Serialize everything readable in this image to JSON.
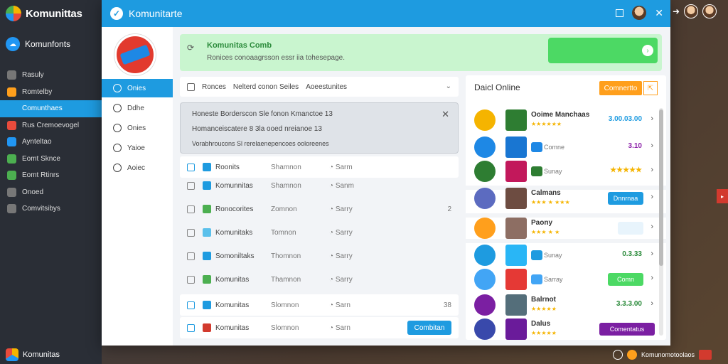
{
  "app": {
    "name": "Komunittas"
  },
  "account": {
    "name": "Komunfonts"
  },
  "sidebar": {
    "items": [
      {
        "label": "Rasuly",
        "color": "#777"
      },
      {
        "label": "Romtelby",
        "color": "#ff9f1c"
      },
      {
        "label": "Comunthaes",
        "color": "#1e9be0"
      },
      {
        "label": "Rus Cremoevogel",
        "color": "#e84b3c"
      },
      {
        "label": "Aynteltao",
        "color": "#2196f3"
      },
      {
        "label": "Eomt Sknce",
        "color": "#4caf50"
      },
      {
        "label": "Eomt Rtinrs",
        "color": "#4caf50"
      },
      {
        "label": "Onoed",
        "color": "#777"
      },
      {
        "label": "Comvitsibys",
        "color": "#777"
      }
    ],
    "active_index": 2,
    "footer": "Komunitas"
  },
  "window": {
    "title": "Komunitarte"
  },
  "inner_nav": {
    "items": [
      "Onies",
      "Ddhe",
      "Onies",
      "Yaioe",
      "Aoiec"
    ],
    "active_index": 0
  },
  "banner": {
    "title": "Komunitas Comb",
    "subtitle": "Ronices conoaagrsson essr iia tohesepage."
  },
  "filter": {
    "label": "Ronces",
    "value": "Nelterd conon Seiles",
    "extra": "Aoeestunites"
  },
  "notice": {
    "lines": [
      "Honeste Borderscon Sle fonon Kmanctoe 13",
      "Homanceiscatere 8 3la ooed nreianoe 13",
      "Vorabhroucons Sl rerelaenepencoes ooloreenes"
    ]
  },
  "list": {
    "rows": [
      {
        "name": "Roonits",
        "col2": "Shamnon",
        "col3": "Sarm",
        "end": "",
        "icon": "#1e9be0",
        "card": true,
        "check": true,
        "action": ""
      },
      {
        "name": "Komunnitas",
        "col2": "Shamnon",
        "col3": "Sanm",
        "end": "",
        "icon": "#1e9be0",
        "card": false,
        "check": false,
        "action": ""
      },
      {
        "name": "Ronocorites",
        "col2": "Zomnon",
        "col3": "Sarry",
        "end": "2",
        "icon": "#4caf50",
        "card": false,
        "check": false,
        "action": ""
      },
      {
        "name": "Komunitaks",
        "col2": "Tomnon",
        "col3": "Sarry",
        "end": "",
        "icon": "#5bc0eb",
        "card": false,
        "check": false,
        "action": ""
      },
      {
        "name": "Somoniltaks",
        "col2": "Thomnon",
        "col3": "Sarry",
        "end": "",
        "icon": "#1e9be0",
        "card": false,
        "check": false,
        "action": ""
      },
      {
        "name": "Komunitas",
        "col2": "Thamnon",
        "col3": "Sarry",
        "end": "",
        "icon": "#4caf50",
        "card": false,
        "check": false,
        "action": ""
      },
      {
        "name": "Komunitas",
        "col2": "Slomnon",
        "col3": "Sarn",
        "end": "38",
        "icon": "#1e9be0",
        "card": true,
        "check": true,
        "action": ""
      },
      {
        "name": "Komunitas",
        "col2": "Slomnon",
        "col3": "Sarn",
        "end": "",
        "icon": "#d23a2e",
        "card": true,
        "check": true,
        "action": "Combitan"
      }
    ]
  },
  "right_panel": {
    "title": "Daicl Online",
    "button": "Comnertto",
    "games": [
      {
        "name": "Ooime Manchaas",
        "sub": "",
        "stars": "★★★★★★",
        "value": "3.00.03.00",
        "value_color": "#1e9be0",
        "pill": "",
        "pill_color": ""
      },
      {
        "name": "",
        "sub": "Comne",
        "stars": "",
        "value": "3.10",
        "value_color": "#8e24aa",
        "pill": "",
        "pill_color": ""
      },
      {
        "name": "",
        "sub": "Sunay",
        "stars": "",
        "value": "★★★★★",
        "value_color": "#f5b400",
        "pill": "",
        "pill_color": ""
      },
      {
        "name": "Calmans",
        "sub": "",
        "stars": "★★★ ★ ★★★",
        "value": "",
        "value_color": "",
        "pill": "Dnnrnaa",
        "pill_color": "#1e9be0"
      },
      {
        "name": "Paony",
        "sub": "",
        "stars": "★★★ ★ ★",
        "value": "",
        "value_color": "",
        "pill": "",
        "pill_color": "#e8f4fc"
      },
      {
        "name": "",
        "sub": "Sunay",
        "stars": "",
        "value": "0.3.33",
        "value_color": "#2a8a3a",
        "pill": "",
        "pill_color": ""
      },
      {
        "name": "",
        "sub": "Sarray",
        "stars": "",
        "value": "",
        "value_color": "",
        "pill": "Comn",
        "pill_color": "#4cd964"
      },
      {
        "name": "Balrnot",
        "sub": "",
        "stars": "★★★★★",
        "value": "3.3.3.00",
        "value_color": "#2a8a3a",
        "pill": "",
        "pill_color": ""
      },
      {
        "name": "Dalus",
        "sub": "",
        "stars": "★★★★★",
        "value": "",
        "value_color": "",
        "pill": "Comentatus",
        "pill_color": "#7b1fa2"
      }
    ]
  },
  "tray": {
    "text": "Komunomotoolaos"
  }
}
